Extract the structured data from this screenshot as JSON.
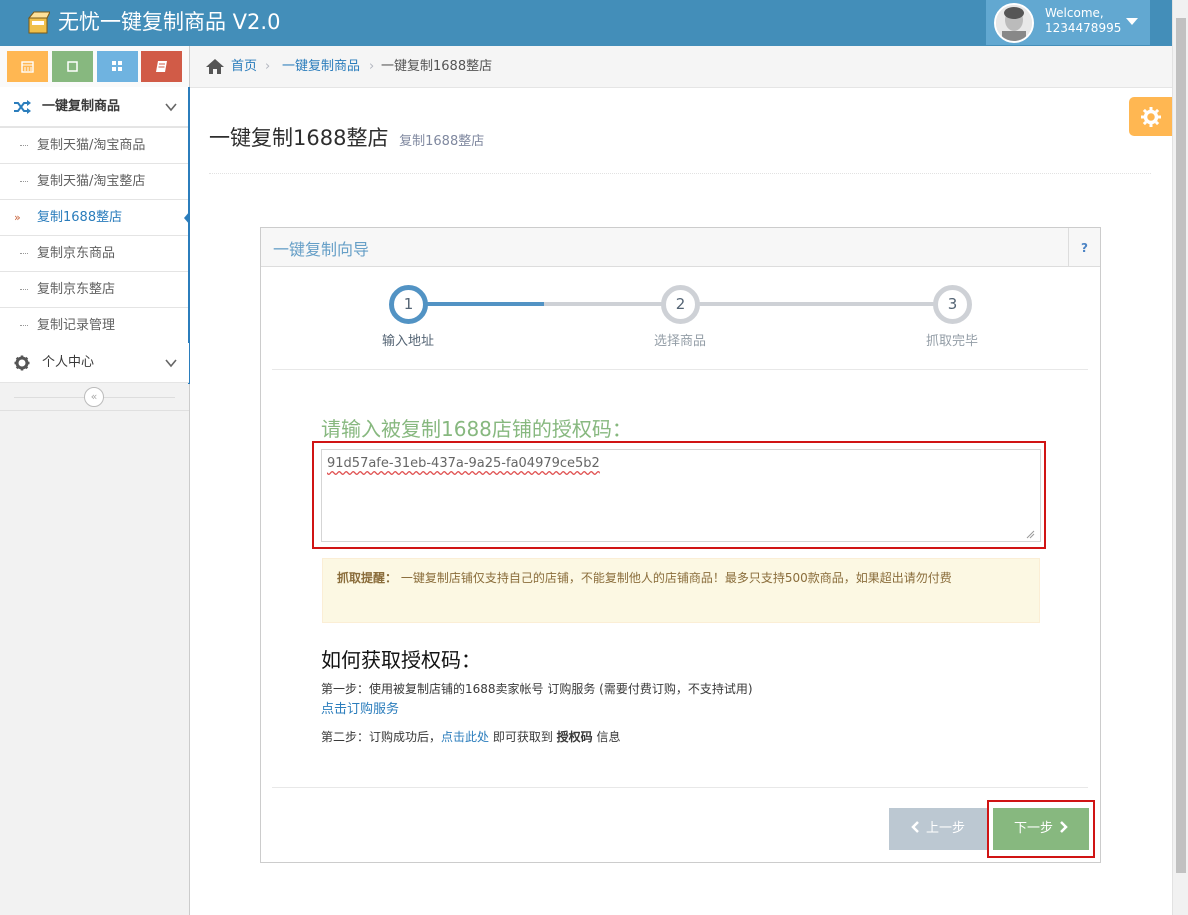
{
  "app": {
    "title": "无忧一键复制商品 V2.0"
  },
  "user": {
    "welcome": "Welcome,",
    "id": "1234478995"
  },
  "shortcuts": [
    {
      "icon": "calendar-icon",
      "color": "#ffb752"
    },
    {
      "icon": "square-icon",
      "color": "#87b87f"
    },
    {
      "icon": "grid-icon",
      "color": "#6fb3e0"
    },
    {
      "icon": "book-icon",
      "color": "#d15b47"
    }
  ],
  "sidebar": {
    "group1": {
      "label": "一键复制商品",
      "icon": "shuffle-icon"
    },
    "items": [
      {
        "label": "复制天猫/淘宝商品"
      },
      {
        "label": "复制天猫/淘宝整店"
      },
      {
        "label": "复制1688整店",
        "active": true
      },
      {
        "label": "复制京东商品"
      },
      {
        "label": "复制京东整店"
      },
      {
        "label": "复制记录管理"
      }
    ],
    "group2": {
      "label": "个人中心",
      "icon": "gear-icon"
    }
  },
  "breadcrumb": {
    "home": "首页",
    "section": "一键复制商品",
    "current": "一键复制1688整店"
  },
  "page": {
    "title": "一键复制1688整店",
    "subtitle": "复制1688整店"
  },
  "wizard": {
    "title": "一键复制向导",
    "help": "?",
    "steps": [
      {
        "num": "1",
        "label": "输入地址"
      },
      {
        "num": "2",
        "label": "选择商品"
      },
      {
        "num": "3",
        "label": "抓取完毕"
      }
    ],
    "active_step": 1,
    "prompt": "请输入被复制1688店铺的授权码：",
    "code_value": "91d57afe-31eb-437a-9a25-fa04979ce5b2",
    "alert_label": "抓取提醒：",
    "alert_text": "一键复制店铺仅支持自己的店铺，不能复制他人的店铺商品！最多只支持500款商品，如果超出请勿付费",
    "how_title": "如何获取授权码：",
    "step1_text": "第一步：使用被复制店铺的1688卖家帐号 订购服务 (需要付费订购，不支持试用)",
    "step1_link": "点击订购服务",
    "step2_prefix": "第二步：订购成功后，",
    "step2_link": "点击此处",
    "step2_mid": " 即可获取到 ",
    "step2_bold": "授权码",
    "step2_suffix": " 信息",
    "prev_label": "上一步",
    "next_label": "下一步"
  }
}
